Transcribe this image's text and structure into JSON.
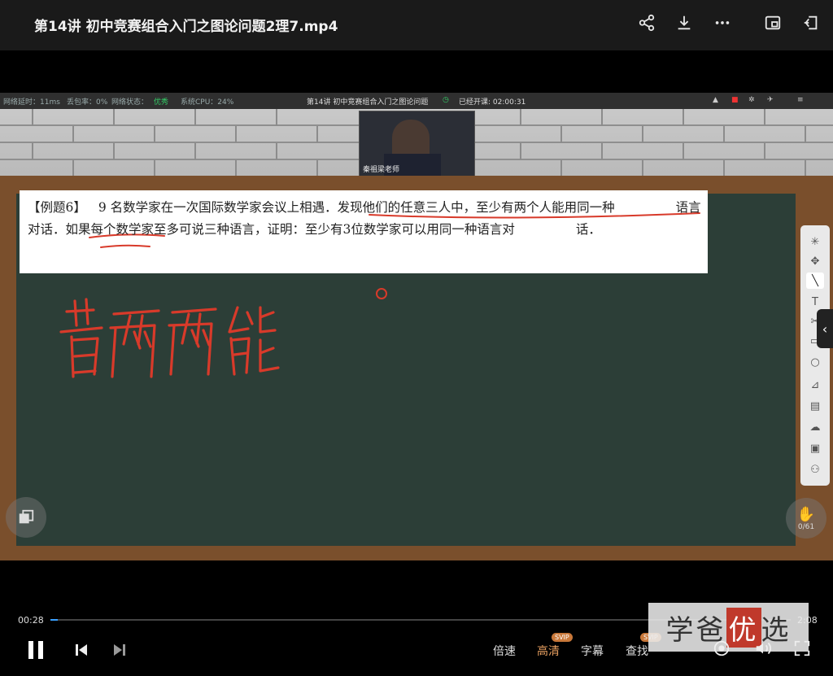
{
  "header": {
    "title": "第14讲  初中竞赛组合入门之图论问题2理7.mp4",
    "icons": [
      "share-icon",
      "download-icon",
      "more-icon",
      "picture-in-picture-icon",
      "pin-icon"
    ]
  },
  "stream_bar": {
    "latency": "网络延时：11ms",
    "loss": "丢包率：0%",
    "net_state_label": "网络状态：",
    "net_state": "优秀",
    "cpu": "系统CPU：24%",
    "lesson_title": "第14讲  初中竞赛组合入门之图论问题",
    "elapsed": "已经开课: 02:00:31"
  },
  "webcam": {
    "teacher": "秦祖梁老师"
  },
  "problem": {
    "label": "【例题6】",
    "text_1": "9 名数学家在一次国际数学家会议上相遇．",
    "text_2": "发现他们的任意三人中，至少有两个人能用同一种",
    "text_3": "语言对话．",
    "text_4": "如果每个数学家至多可说三种语言，证明：至少有3位数学家可以用同一种语言对",
    "text_5": "话．"
  },
  "handwriting": "若两两能",
  "hand_counter": "0/61",
  "player": {
    "current_time": "00:28",
    "total_time": "2:08",
    "progress": 0.01,
    "speed_label": "倍速",
    "quality_label": "高清",
    "subtitle_label": "字幕",
    "search_label": "查找",
    "svip": "SVIP"
  },
  "watermark": {
    "a": "学爸",
    "b": "优",
    "c": "选"
  },
  "colors": {
    "accent": "#3aa0ff",
    "quality": "#e8a060",
    "ink": "#d83a2a"
  }
}
